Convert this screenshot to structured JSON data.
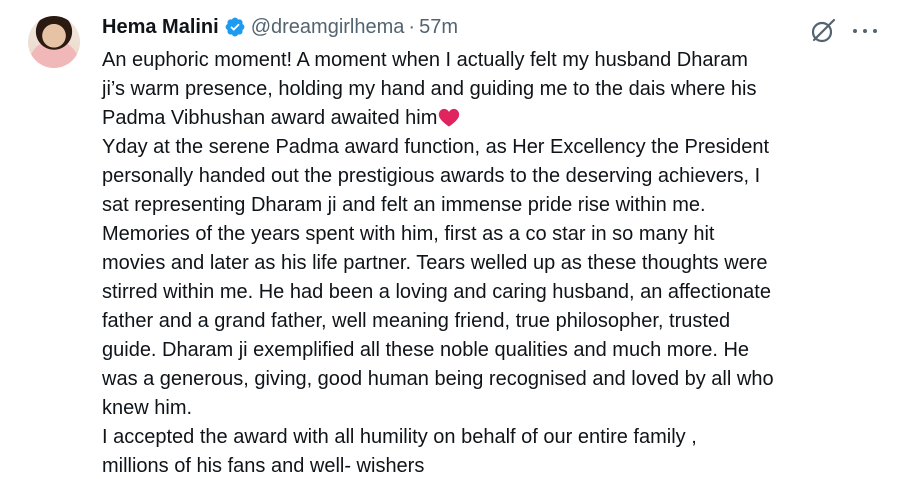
{
  "author": {
    "name": "Hema Malini",
    "handle": "@dreamgirlhema",
    "separator": "·",
    "time": "57m"
  },
  "colors": {
    "verified_badge": "#1d9bf0",
    "secondary_text": "#536471",
    "primary_text": "#0f1419",
    "heart": "#e0245e"
  },
  "icons": {
    "verified": "verified-badge-icon",
    "grok": "grok-icon",
    "more": "more-options-icon",
    "heart": "red-heart-emoji"
  },
  "tweet": {
    "lines": [
      "An euphoric moment! A moment when I actually felt my husband Dharam",
      "ji’s warm presence, holding my hand and guiding me to the dais where his",
      "Padma Vibhushan award awaited him",
      "Yday at the serene Padma award function, as Her Excellency the President",
      "personally handed out the prestigious awards to the deserving achievers, I",
      "sat representing Dharam ji and felt an immense pride rise within me.",
      "Memories of the years spent with him, first as a co star in so many hit",
      "movies and later as his life partner. Tears welled up as these thoughts were",
      "stirred within me. He had been a loving and caring husband, an affectionate",
      "father and a grand father, well meaning friend, true philosopher, trusted",
      "guide. Dharam ji exemplified all these noble qualities and much more. He",
      "was a generous, giving, good human being recognised and loved by all who",
      "knew him.",
      "I accepted the award with all humility on behalf of our entire family ,",
      "millions of his fans and well- wishers"
    ]
  }
}
